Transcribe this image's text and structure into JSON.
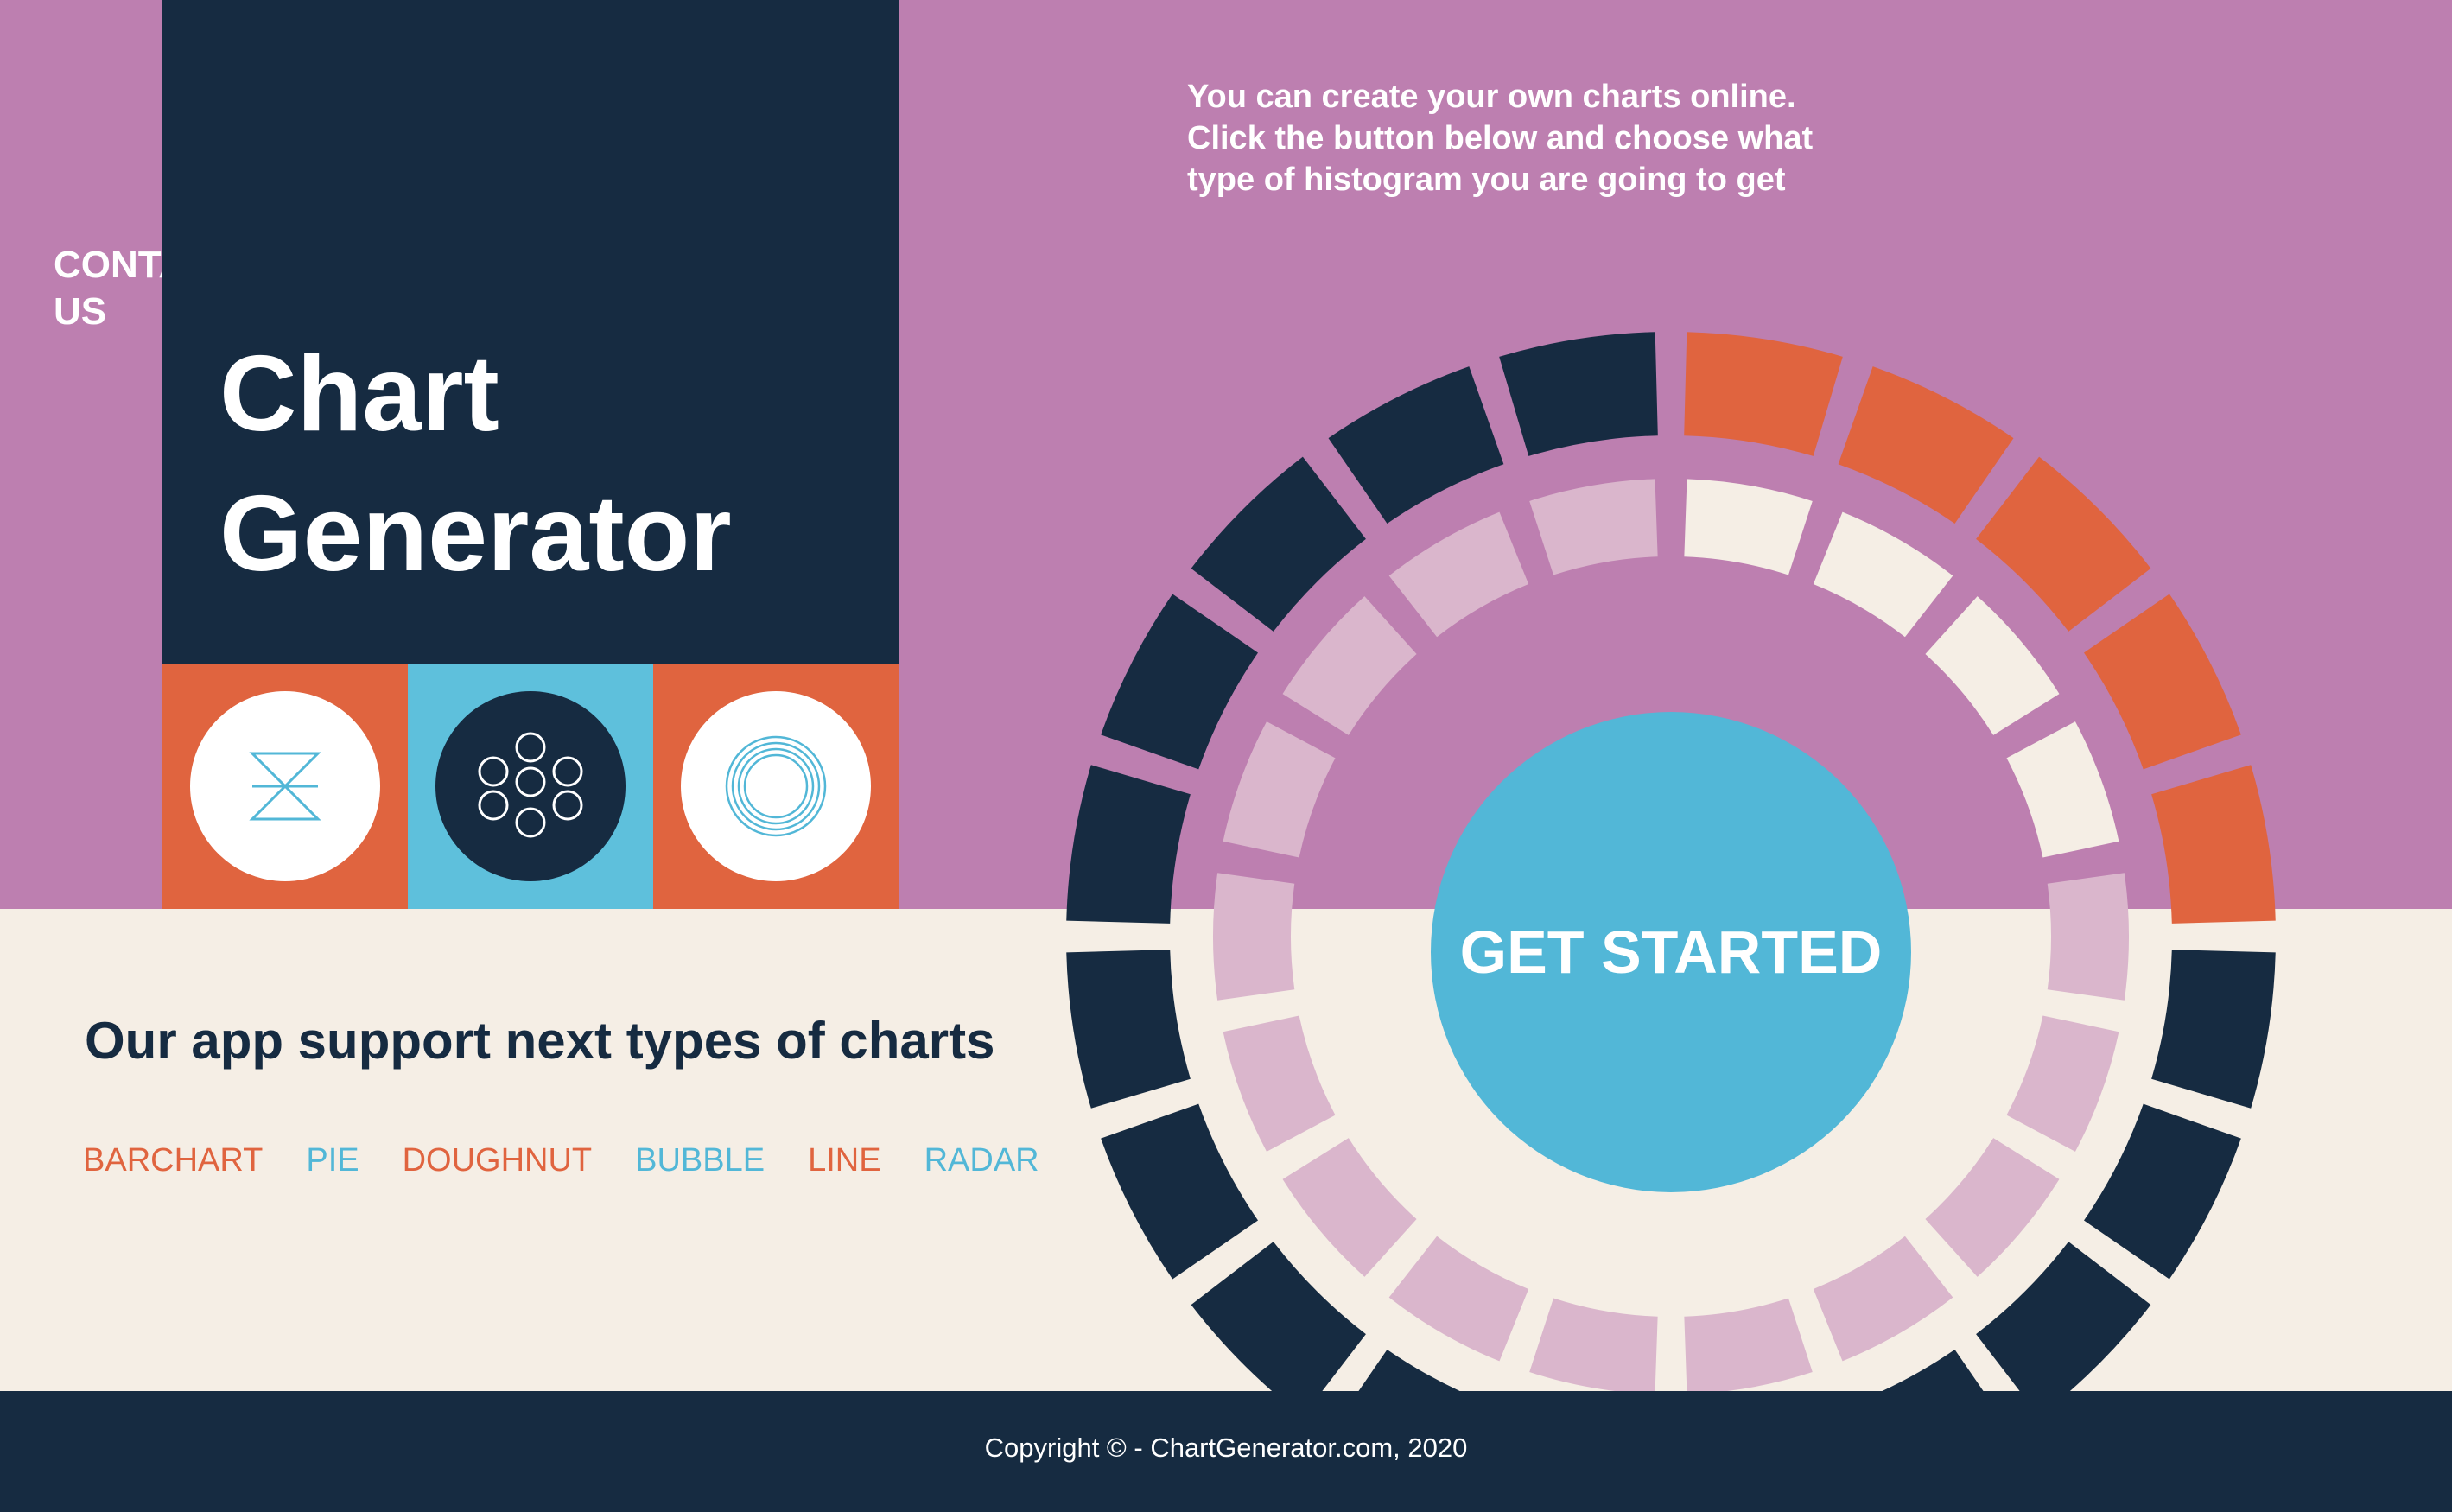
{
  "nav": {
    "contact_label": "CONTACT\nUS"
  },
  "hero": {
    "title": "Chart\nGenerator",
    "intro": "You can create your own charts online.\nClick the button below and choose what\ntype of histogram you are going to get",
    "cta_label": "GET STARTED"
  },
  "icons": [
    {
      "name": "hourglass-icon",
      "tile_color": "#e0643f",
      "circle_color": "#ffffff"
    },
    {
      "name": "bubbles-icon",
      "tile_color": "#5ec0dc",
      "circle_color": "#162b41"
    },
    {
      "name": "concentric-rings-icon",
      "tile_color": "#e0643f",
      "circle_color": "#ffffff"
    }
  ],
  "supported": {
    "heading": "Our app support next types of charts",
    "types": [
      {
        "label": "BARCHART",
        "color": "#e0643f"
      },
      {
        "label": "PIE",
        "color": "#52b7d7"
      },
      {
        "label": "DOUGHNUT",
        "color": "#e0643f"
      },
      {
        "label": "BUBBLE",
        "color": "#52b7d7"
      },
      {
        "label": "LINE",
        "color": "#e0643f"
      },
      {
        "label": "RADAR",
        "color": "#52b7d7"
      }
    ]
  },
  "colors": {
    "navy": "#162b41",
    "purple": "#bd7fb0",
    "cream": "#f5eee5",
    "orange": "#e0643f",
    "light_blue": "#52b7d7",
    "light_pink": "#dab6cc"
  },
  "footer": {
    "copyright": "Copyright © - ChartGenerator.com, 2020"
  }
}
